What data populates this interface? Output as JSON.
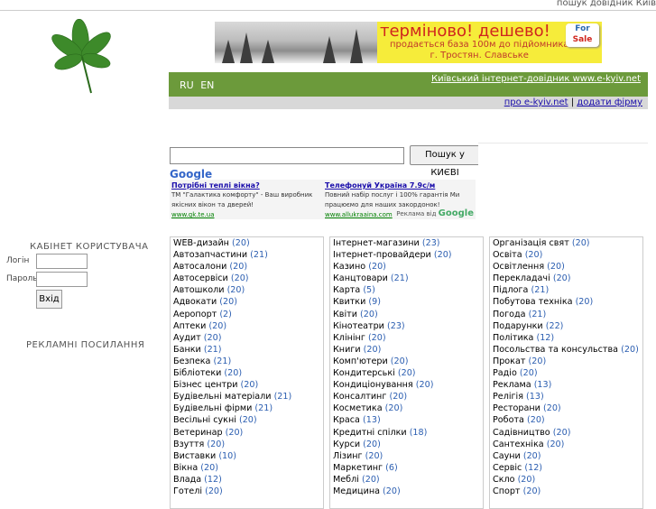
{
  "top_strip": "пошук довідник Київ",
  "banner": {
    "headline": "терміново! дешево!",
    "sub_line1": "продається база 100м до підйомника",
    "sub_line2": "г. Тростян. Славське",
    "sale_line1": "For",
    "sale_line2": "Sale"
  },
  "header": {
    "lang_ru": "RU",
    "lang_en": "EN",
    "site_link": "Київський інтернет-довідник www.e-kyiv.net",
    "about_link": "про e-kyiv.net",
    "separator": "|",
    "add_link": "додати фірму"
  },
  "search": {
    "value": "",
    "button": "Пошук у КИЄВІ",
    "google": "Google"
  },
  "google_ads": {
    "ad1": {
      "title": "Потрібні теплі вікна?",
      "desc": "ТМ \"Галактика комфорту\" - Ваш виробник якісних вікон та дверей!",
      "url": "www.gk.te.ua"
    },
    "ad2": {
      "title": "Телефонуй Україна 7.9с/м",
      "desc": "Повний набір послуг і 100% гарантія Ми працюємо для наших закордонок!",
      "url": "www.allukraaina.com"
    },
    "footer": "Реклама від",
    "footer_brand": "Google"
  },
  "cabinet": {
    "title": "КАБІНЕТ КОРИСТУВАЧА",
    "login_label": "Логін",
    "password_label": "Пароль",
    "submit": "Вхід",
    "ads_title": "РЕКЛАМНІ ПОСИЛАННЯ"
  },
  "categories": {
    "col1": [
      {
        "name": "WEB-дизайн",
        "count": "(20)"
      },
      {
        "name": "Автозапчастини",
        "count": "(21)"
      },
      {
        "name": "Автосалони",
        "count": "(20)"
      },
      {
        "name": "Автосервіси",
        "count": "(20)"
      },
      {
        "name": "Автошколи",
        "count": "(20)"
      },
      {
        "name": "Адвокати",
        "count": "(20)"
      },
      {
        "name": "Аеропорт",
        "count": "(2)"
      },
      {
        "name": "Аптеки",
        "count": "(20)"
      },
      {
        "name": "Аудит",
        "count": "(20)"
      },
      {
        "name": "Банки",
        "count": "(21)"
      },
      {
        "name": "Безпека",
        "count": "(21)"
      },
      {
        "name": "Бібліотеки",
        "count": "(20)"
      },
      {
        "name": "Бізнес центри",
        "count": "(20)"
      },
      {
        "name": "Будівельні матеріали",
        "count": "(21)"
      },
      {
        "name": "Будівельні фірми",
        "count": "(21)"
      },
      {
        "name": "Весільні сукні",
        "count": "(20)"
      },
      {
        "name": "Ветеринар",
        "count": "(20)"
      },
      {
        "name": "Взуття",
        "count": "(20)"
      },
      {
        "name": "Виставки",
        "count": "(10)"
      },
      {
        "name": "Вікна",
        "count": "(20)"
      },
      {
        "name": "Влада",
        "count": "(12)"
      },
      {
        "name": "Готелі",
        "count": "(20)"
      }
    ],
    "col2": [
      {
        "name": "Інтернет-магазини",
        "count": "(23)"
      },
      {
        "name": "Інтернет-провайдери",
        "count": "(20)"
      },
      {
        "name": "Казино",
        "count": "(20)"
      },
      {
        "name": "Канцтовари",
        "count": "(21)"
      },
      {
        "name": "Карта",
        "count": "(5)"
      },
      {
        "name": "Квитки",
        "count": "(9)"
      },
      {
        "name": "Квіти",
        "count": "(20)"
      },
      {
        "name": "Кінотеатри",
        "count": "(23)"
      },
      {
        "name": "Клінінг",
        "count": "(20)"
      },
      {
        "name": "Книги",
        "count": "(20)"
      },
      {
        "name": "Комп'ютери",
        "count": "(20)"
      },
      {
        "name": "Кондитерські",
        "count": "(20)"
      },
      {
        "name": "Кондиціонування",
        "count": "(20)"
      },
      {
        "name": "Консалтинг",
        "count": "(20)"
      },
      {
        "name": "Косметика",
        "count": "(20)"
      },
      {
        "name": "Краса",
        "count": "(13)"
      },
      {
        "name": "Кредитні спілки",
        "count": "(18)"
      },
      {
        "name": "Курси",
        "count": "(20)"
      },
      {
        "name": "Лізинг",
        "count": "(20)"
      },
      {
        "name": "Маркетинг",
        "count": "(6)"
      },
      {
        "name": "Меблі",
        "count": "(20)"
      },
      {
        "name": "Медицина",
        "count": "(20)"
      }
    ],
    "col3": [
      {
        "name": "Організація свят",
        "count": "(20)"
      },
      {
        "name": "Освіта",
        "count": "(20)"
      },
      {
        "name": "Освітлення",
        "count": "(20)"
      },
      {
        "name": "Перекладачі",
        "count": "(20)"
      },
      {
        "name": "Підлога",
        "count": "(21)"
      },
      {
        "name": "Побутова техніка",
        "count": "(20)"
      },
      {
        "name": "Погода",
        "count": "(21)"
      },
      {
        "name": "Подарунки",
        "count": "(22)"
      },
      {
        "name": "Політика",
        "count": "(12)"
      },
      {
        "name": "Посольства та консульства",
        "count": "(20)"
      },
      {
        "name": "Прокат",
        "count": "(20)"
      },
      {
        "name": "Радіо",
        "count": "(20)"
      },
      {
        "name": "Реклама",
        "count": "(13)"
      },
      {
        "name": "Релігія",
        "count": "(13)"
      },
      {
        "name": "Ресторани",
        "count": "(20)"
      },
      {
        "name": "Робота",
        "count": "(20)"
      },
      {
        "name": "Садівництво",
        "count": "(20)"
      },
      {
        "name": "Сантехніка",
        "count": "(20)"
      },
      {
        "name": "Сауни",
        "count": "(20)"
      },
      {
        "name": "Сервіс",
        "count": "(12)"
      },
      {
        "name": "Скло",
        "count": "(20)"
      },
      {
        "name": "Спорт",
        "count": "(20)"
      }
    ]
  }
}
